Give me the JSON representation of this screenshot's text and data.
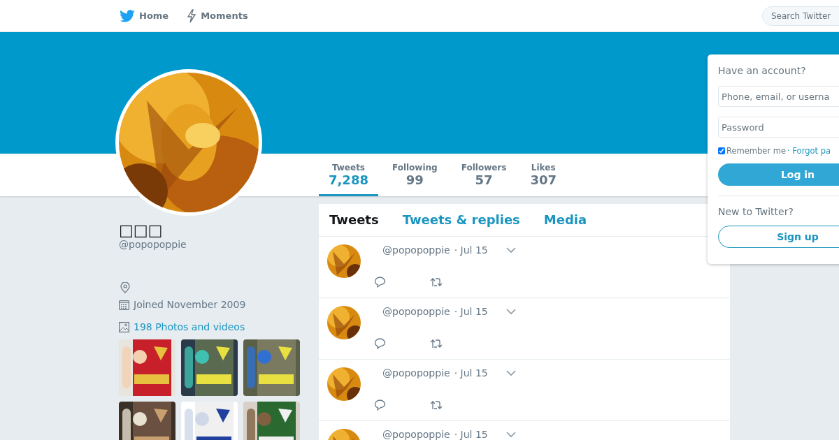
{
  "nav": {
    "items": [
      {
        "label": "Home",
        "kind": "bird"
      },
      {
        "label": "Moments",
        "kind": "bolt"
      }
    ],
    "search": {
      "placeholder": "Search Twitter"
    }
  },
  "profile": {
    "name": "□□□",
    "handle": "@popopoppie",
    "joined": "Joined November 2009",
    "photos_link": "198 Photos and videos"
  },
  "stats": [
    {
      "label": "Tweets",
      "value": "7,288",
      "selected": true
    },
    {
      "label": "Following",
      "value": "99",
      "selected": false
    },
    {
      "label": "Followers",
      "value": "57",
      "selected": false
    },
    {
      "label": "Likes",
      "value": "307",
      "selected": false
    }
  ],
  "timeline_tabs": [
    {
      "label": "Tweets",
      "selected": true
    },
    {
      "label": "Tweets & replies",
      "selected": false
    },
    {
      "label": "Media",
      "selected": false
    }
  ],
  "tweets": [
    {
      "handle": "@popopoppie",
      "time": "· Jul 15"
    },
    {
      "handle": "@popopoppie",
      "time": "· Jul 15"
    },
    {
      "handle": "@popopoppie",
      "time": "· Jul 15"
    },
    {
      "handle": "@popopoppie",
      "time": "· Jul 15"
    }
  ],
  "login": {
    "title": "Have an account?",
    "username_placeholder": "Phone, email, or userna",
    "password_placeholder": "Password",
    "remember": {
      "label": "Remember me",
      "checked": true
    },
    "forgot_link": "· Forgot pa",
    "login_button": "Log in",
    "new_title": "New to Twitter?",
    "signup_button": "Sign up"
  }
}
